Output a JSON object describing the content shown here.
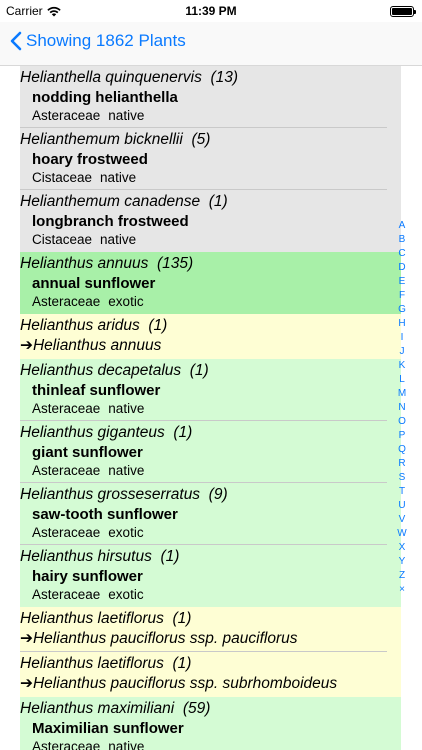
{
  "status": {
    "carrier": "Carrier",
    "time": "11:39 PM"
  },
  "nav": {
    "back_label": "Showing 1862 Plants"
  },
  "rows": [
    {
      "sci": "Helianthella quinquenervis",
      "count": "(13)",
      "common": "nodding helianthella",
      "family": "Asteraceae",
      "status": "native",
      "bg": "gray"
    },
    {
      "sci": "Helianthemum bicknellii",
      "count": "(5)",
      "common": "hoary frostweed",
      "family": "Cistaceae",
      "status": "native",
      "bg": "gray"
    },
    {
      "sci": "Helianthemum canadense",
      "count": "(1)",
      "common": "longbranch frostweed",
      "family": "Cistaceae",
      "status": "native",
      "bg": "gray"
    },
    {
      "sci": "Helianthus annuus",
      "count": "(135)",
      "common": "annual sunflower",
      "family": "Asteraceae",
      "status": "exotic",
      "bg": "green"
    },
    {
      "sci": "Helianthus aridus",
      "count": "(1)",
      "synonym": "➔Helianthus annuus",
      "bg": "yellow"
    },
    {
      "sci": "Helianthus decapetalus",
      "count": "(1)",
      "common": "thinleaf sunflower",
      "family": "Asteraceae",
      "status": "native",
      "bg": "lightgreen"
    },
    {
      "sci": "Helianthus giganteus",
      "count": "(1)",
      "common": "giant sunflower",
      "family": "Asteraceae",
      "status": "native",
      "bg": "lightgreen"
    },
    {
      "sci": "Helianthus grosseserratus",
      "count": "(9)",
      "common": "saw-tooth sunflower",
      "family": "Asteraceae",
      "status": "exotic",
      "bg": "lightgreen"
    },
    {
      "sci": "Helianthus hirsutus",
      "count": "(1)",
      "common": "hairy sunflower",
      "family": "Asteraceae",
      "status": "exotic",
      "bg": "lightgreen"
    },
    {
      "sci": "Helianthus laetiflorus",
      "count": "(1)",
      "synonym": "➔Helianthus pauciflorus ssp. pauciflorus",
      "bg": "yellow"
    },
    {
      "sci": "Helianthus laetiflorus",
      "count": "(1)",
      "synonym": "➔Helianthus pauciflorus ssp. subrhomboideus",
      "bg": "yellow"
    },
    {
      "sci": "Helianthus maximiliani",
      "count": "(59)",
      "common": "Maximilian sunflower",
      "family": "Asteraceae",
      "status": "native",
      "bg": "lightgreen"
    }
  ],
  "index_letters": [
    "A",
    "B",
    "C",
    "D",
    "E",
    "F",
    "G",
    "H",
    "I",
    "J",
    "K",
    "L",
    "M",
    "N",
    "O",
    "P",
    "Q",
    "R",
    "S",
    "T",
    "U",
    "V",
    "W",
    "X",
    "Y",
    "Z",
    "×"
  ],
  "colors": {
    "accent": "#0a7aff",
    "gray": "#e6e6e6",
    "green": "#a8f0a8",
    "lightgreen": "#d4fbd4",
    "yellow": "#fefed4"
  }
}
